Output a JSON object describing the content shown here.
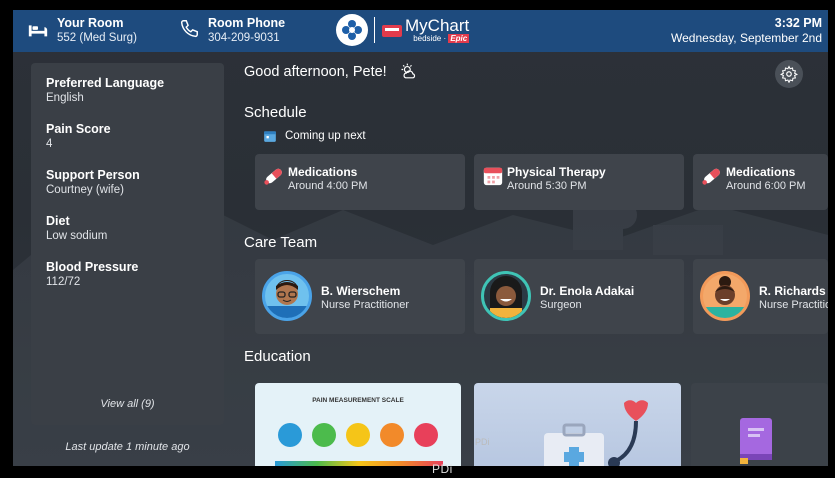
{
  "header": {
    "room_label": "Your Room",
    "room_value": "552 (Med Surg)",
    "phone_label": "Room Phone",
    "phone_value": "304-209-9031",
    "brand_name": "MyChart",
    "brand_sub": "bedside",
    "brand_vendor": "Epic",
    "time": "3:32 PM",
    "date": "Wednesday, September 2nd",
    "bar_color": "#1e4b7e"
  },
  "info_panel": {
    "items": [
      {
        "label": "Preferred Language",
        "value": "English"
      },
      {
        "label": "Pain Score",
        "value": "4"
      },
      {
        "label": "Support Person",
        "value": "Courtney (wife)"
      },
      {
        "label": "Diet",
        "value": "Low sodium"
      },
      {
        "label": "Blood Pressure",
        "value": "112/72"
      }
    ],
    "view_all": "View all (9)",
    "last_update": "Last update 1 minute ago"
  },
  "greeting": "Good afternoon, Pete!",
  "weather_icon": "partly-sunny-icon",
  "schedule": {
    "title": "Schedule",
    "coming_up": "Coming up next",
    "items": [
      {
        "icon": "pill-icon",
        "title": "Medications",
        "time": "Around 4:00 PM"
      },
      {
        "icon": "calendar-icon",
        "title": "Physical Therapy",
        "time": "Around 5:30 PM"
      },
      {
        "icon": "pill-icon",
        "title": "Medications",
        "time": "Around 6:00 PM"
      }
    ]
  },
  "care_team": {
    "title": "Care Team",
    "members": [
      {
        "name": "B. Wierschem",
        "role": "Nurse Practitioner"
      },
      {
        "name": "Dr. Enola Adakai",
        "role": "Surgeon"
      },
      {
        "name": "R. Richards",
        "role": "Nurse Practitioner"
      }
    ]
  },
  "education": {
    "title": "Education",
    "cards": [
      {
        "title": "PAIN MEASUREMENT SCALE"
      },
      {
        "title": ""
      },
      {
        "title": ""
      }
    ]
  },
  "watermark": "PDi",
  "watermark_small": "PDi"
}
